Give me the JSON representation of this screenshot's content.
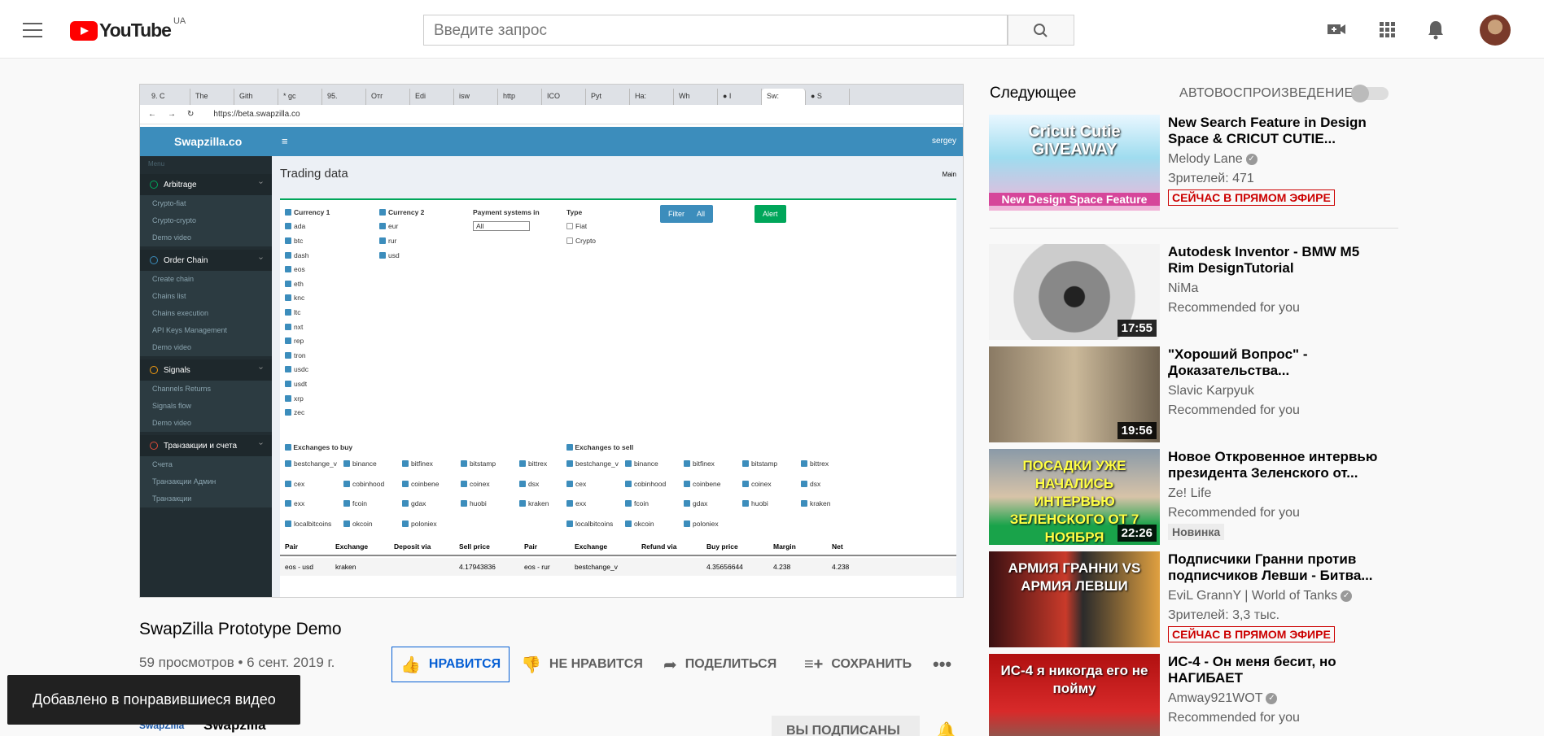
{
  "header": {
    "logo_text": "YouTube",
    "region": "UA",
    "search_placeholder": "Введите запрос"
  },
  "player": {
    "tabs": [
      "9. C",
      "The",
      "Gith",
      "* gc",
      "95.",
      "Отг",
      "Edi",
      "isw",
      "http",
      "ICO",
      "Pyt",
      "Ha:",
      "Wh",
      "● I",
      "Sw:",
      "● S"
    ],
    "url": "https://beta.swapzilla.co",
    "brand": "Swapzilla.co",
    "user": "sergey",
    "page_title": "Trading data",
    "crumb": "Main",
    "menu_label": "Menu",
    "sections": [
      {
        "title": "Arbitrage",
        "items": [
          "Crypto-fiat",
          "Crypto-crypto",
          "Demo video"
        ]
      },
      {
        "title": "Order Chain",
        "items": [
          "Create chain",
          "Chains list",
          "Chains execution",
          "API Keys Management",
          "Demo video"
        ]
      },
      {
        "title": "Signals",
        "items": [
          "Channels Returns",
          "Signals flow",
          "Demo video"
        ]
      },
      {
        "title": "Транзакции и счета",
        "items": [
          "Счета",
          "Транзакции Админ",
          "Транзакции"
        ]
      }
    ],
    "currency1_label": "Currency 1",
    "currency1": [
      "ada",
      "btc",
      "dash",
      "eos",
      "eth",
      "knc",
      "ltc",
      "nxt",
      "rep",
      "tron",
      "usdc",
      "usdt",
      "xrp",
      "zec"
    ],
    "currency2_label": "Currency 2",
    "currency2": [
      "eur",
      "rur",
      "usd"
    ],
    "payment_label": "Payment systems in",
    "payment_value": "All",
    "type_label": "Type",
    "types": [
      "Fiat",
      "Crypto"
    ],
    "btn_filter": "Filter",
    "btn_all": "All",
    "btn_alert": "Alert",
    "buy_label": "Exchanges to buy",
    "sell_label": "Exchanges to sell",
    "exchanges": [
      [
        "bestchange_v",
        "binance",
        "bitfinex",
        "bitstamp",
        "bittrex"
      ],
      [
        "cex",
        "cobinhood",
        "coinbene",
        "coinex",
        "dsx"
      ],
      [
        "exx",
        "fcoin",
        "gdax",
        "huobi",
        "kraken"
      ],
      [
        "localbitcoins",
        "okcoin",
        "poloniex"
      ]
    ],
    "columns": [
      "Pair",
      "Exchange",
      "Deposit via",
      "Sell price",
      "Pair",
      "Exchange",
      "Refund via",
      "Buy price",
      "Margin",
      "Net"
    ],
    "row": [
      "eos - usd",
      "kraken",
      "",
      "4.17943836",
      "eos - rur",
      "bestchange_v",
      "",
      "4.35656644",
      "4.238",
      "4.238"
    ]
  },
  "video": {
    "title": "SwapZilla Prototype Demo",
    "meta": "59 просмотров • 6 сент. 2019 г.",
    "like": "НРАВИТСЯ",
    "dislike": "НЕ НРАВИТСЯ",
    "share": "ПОДЕЛИТЬСЯ",
    "save": "СОХРАНИТЬ",
    "channel": "Swapzilla",
    "subscribed": "ВЫ ПОДПИСАНЫ"
  },
  "toast": "Добавлено в понравившиеся видео",
  "sidebar": {
    "next": "Следующее",
    "autoplay": "АВТОВОСПРОИЗВЕДЕНИЕ",
    "videos": [
      {
        "title": "New Search Feature in Design Space & CRICUT CUTIE...",
        "channel": "Melody Lane",
        "verified": true,
        "meta": "Зрителей: 471",
        "badge": "СЕЙЧАС В ПРЯМОМ ЭФИРЕ",
        "thumb_text": "Cricut Cutie GIVEAWAY",
        "thumb_sub": "New Design Space Feature"
      },
      {
        "title": "Autodesk Inventor - BMW M5 Rim DesignTutorial",
        "channel": "NiMa",
        "meta": "Recommended for you",
        "duration": "17:55"
      },
      {
        "title": "\"Хороший Вопрос\" - Доказательства...",
        "channel": "Slavic Karpyuk",
        "meta": "Recommended for you",
        "duration": "19:56"
      },
      {
        "title": "Новое Откровенное интервью президента Зеленского от...",
        "channel": "Ze! Life",
        "meta": "Recommended for you",
        "badge": "Новинка",
        "duration": "22:26",
        "thumb_text": "ПОСАДКИ УЖЕ НАЧАЛИСЬ ИНТЕРВЬЮ ЗЕЛЕНСКОГО ОТ 7 НОЯБРЯ"
      },
      {
        "title": "Подписчики Гранни против подписчиков Левши - Битва...",
        "channel": "EviL GrannY | World of Tanks",
        "verified": true,
        "meta": "Зрителей: 3,3 тыс.",
        "badge": "СЕЙЧАС В ПРЯМОМ ЭФИРЕ",
        "thumb_text": "АРМИЯ ГРАННИ VS АРМИЯ ЛЕВШИ"
      },
      {
        "title": "ИС-4 - Он меня бесит, но НАГИБАЕТ",
        "channel": "Amway921WOT",
        "verified": true,
        "meta": "Recommended for you",
        "thumb_text": "ИС-4 я никогда его не пойму"
      }
    ]
  }
}
